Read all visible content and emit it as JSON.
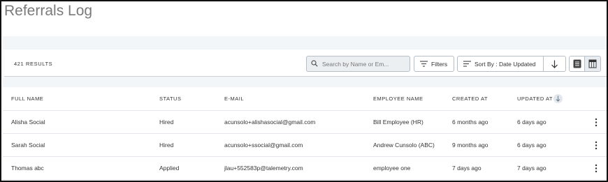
{
  "page": {
    "title": "Referrals Log"
  },
  "toolbar": {
    "results_count": "421 RESULTS",
    "search_placeholder": "Search by Name or Em...",
    "filters_label": "Filters",
    "sort_label": "Sort By : Date Updated"
  },
  "table": {
    "columns": [
      "FULL NAME",
      "STATUS",
      "E-MAIL",
      "EMPLOYEE NAME",
      "CREATED AT",
      "UPDATED AT"
    ],
    "rows": [
      [
        "Alisha Social",
        "Hired",
        "acunsolo+alishasocial@gmail.com",
        "Bill Employee (HR)",
        "6 months ago",
        "6 days ago"
      ],
      [
        "Sarah Social",
        "Hired",
        "acunsolo+ssocial@gmail.com",
        "Andrew Cunsolo (ABC)",
        "9 months ago",
        "6 days ago"
      ],
      [
        "Thomas abc",
        "Applied",
        "jlau+552583p@talemetry.com",
        "employee one",
        "7 days ago",
        "7 days ago"
      ]
    ]
  },
  "icons": {
    "search": "search-icon",
    "filters": "filter-lines-icon",
    "sort": "sort-lines-icon",
    "sort_direction": "arrow-down-icon",
    "list_view": "list-view-icon",
    "table_view": "table-view-icon",
    "row_actions": "kebab-menu-icon"
  },
  "colors": {
    "border": "#b7bec6",
    "band": "#f3f6f9",
    "title": "#7a7a7a"
  }
}
